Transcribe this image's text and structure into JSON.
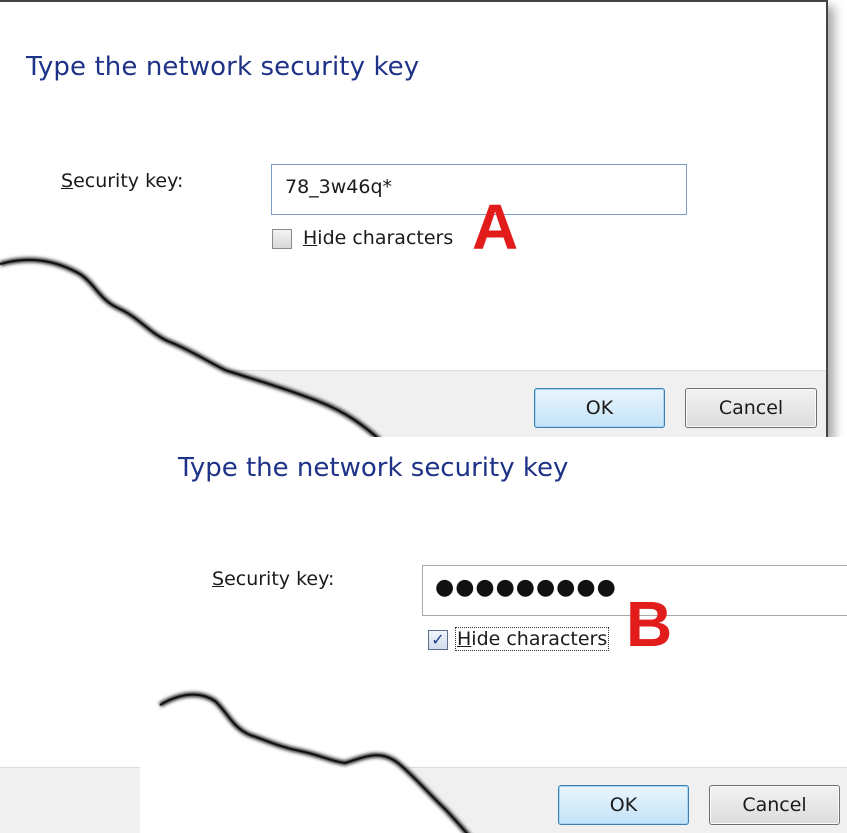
{
  "panel_a": {
    "title": "Type the network security key",
    "security_key_label_accel": "S",
    "security_key_label_rest": "ecurity key:",
    "security_key_value": "78_3w46q*",
    "hide_characters_accel": "H",
    "hide_characters_rest": "ide characters",
    "hide_characters_checked": false,
    "marker": "A",
    "ok_label": "OK",
    "cancel_label": "Cancel"
  },
  "panel_b": {
    "title": "Type the network security key",
    "security_key_label_accel": "S",
    "security_key_label_rest": "ecurity key:",
    "security_key_masked": "●●●●●●●●●",
    "hide_characters_accel": "H",
    "hide_characters_rest": "ide characters",
    "hide_characters_checked": true,
    "check_glyph": "✓",
    "marker": "B",
    "ok_label": "OK",
    "cancel_label": "Cancel"
  },
  "colors": {
    "title": "#1e3287",
    "marker": "#e21b1b",
    "default_button_border": "#3c7fb1",
    "footer_bg": "#f0f0f0"
  }
}
